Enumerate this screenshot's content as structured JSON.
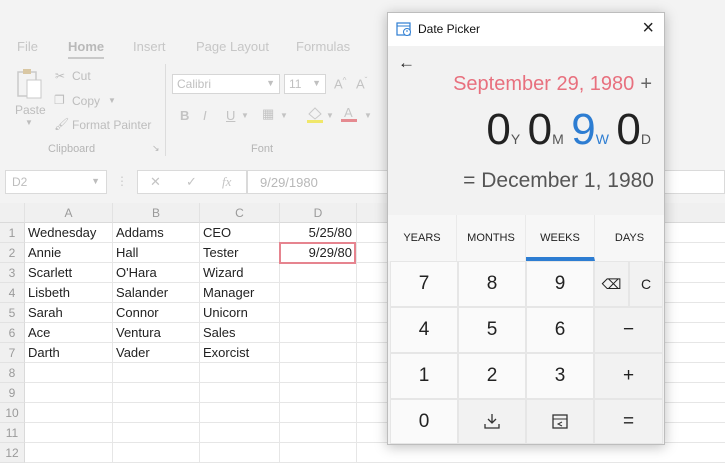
{
  "excel": {
    "tabs": [
      "File",
      "Home",
      "Insert",
      "Page Layout",
      "Formulas"
    ],
    "clipboard": {
      "paste": "Paste",
      "cut": "Cut",
      "copy": "Copy",
      "format_painter": "Format Painter",
      "group": "Clipboard"
    },
    "font": {
      "name": "Calibri",
      "size": "11",
      "group": "Font"
    },
    "name_box": "D2",
    "formula": "9/29/1980",
    "fx": "fx",
    "columns": [
      "A",
      "B",
      "C",
      "D"
    ],
    "rows": [
      "1",
      "2",
      "3",
      "4",
      "5",
      "6",
      "7",
      "8",
      "9",
      "10",
      "11",
      "12"
    ],
    "cells": [
      [
        "Wednesday",
        "Addams",
        "CEO",
        "5/25/80"
      ],
      [
        "Annie",
        "Hall",
        "Tester",
        "9/29/80"
      ],
      [
        "Scarlett",
        "O'Hara",
        "Wizard",
        ""
      ],
      [
        "Lisbeth",
        "Salander",
        "Manager",
        ""
      ],
      [
        "Sarah",
        "Connor",
        "Unicorn",
        ""
      ],
      [
        "Ace",
        "Ventura",
        "Sales",
        ""
      ],
      [
        "Darth",
        "Vader",
        "Exorcist",
        ""
      ]
    ]
  },
  "dialog": {
    "title": "Date Picker",
    "start_date": "September 29, 1980",
    "plus": "+",
    "years": "0",
    "years_unit": "Y",
    "months": "0",
    "months_unit": "M",
    "weeks": "9",
    "weeks_unit": "W",
    "days": "0",
    "days_unit": "D",
    "equals": "=",
    "result_date": "December 1, 1980",
    "tabs": [
      "YEARS",
      "MONTHS",
      "WEEKS",
      "DAYS"
    ],
    "active_tab": "WEEKS",
    "keys": {
      "k7": "7",
      "k8": "8",
      "k9": "9",
      "k4": "4",
      "k5": "5",
      "k6": "6",
      "k1": "1",
      "k2": "2",
      "k3": "3",
      "k0": "0",
      "clear": "C",
      "minus": "−",
      "plus": "+",
      "equals": "="
    },
    "accent": "#2d7dd2",
    "start_color": "#e8707e"
  }
}
